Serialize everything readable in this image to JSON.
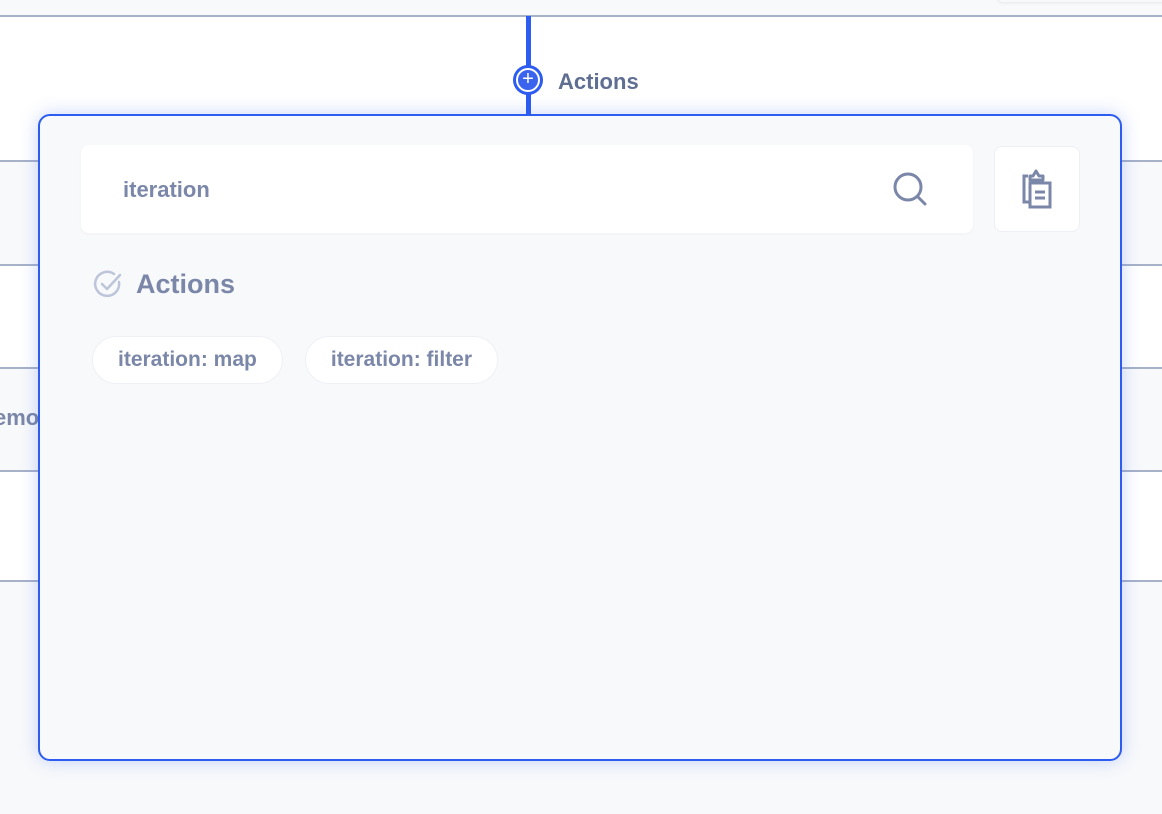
{
  "flow": {
    "add_step_label": "Actions",
    "background_partial_text": "emo"
  },
  "popover": {
    "search": {
      "value": "iteration",
      "placeholder": ""
    },
    "section_title": "Actions",
    "actions": [
      {
        "label": "iteration: map"
      },
      {
        "label": "iteration: filter"
      }
    ]
  },
  "colors": {
    "accent": "#2c5cf0",
    "text_muted": "#7b87a8"
  },
  "icons": {
    "add": "plus-circle-icon",
    "search": "search-icon",
    "paste": "clipboard-icon",
    "section": "check-circle-icon"
  }
}
